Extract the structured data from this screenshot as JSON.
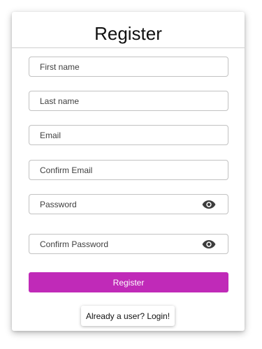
{
  "form": {
    "title": "Register",
    "fields": [
      {
        "placeholder": "First name",
        "value": ""
      },
      {
        "placeholder": "Last name",
        "value": ""
      },
      {
        "placeholder": "Email",
        "value": ""
      },
      {
        "placeholder": "Confirm Email",
        "value": ""
      },
      {
        "placeholder": "Password",
        "value": "",
        "icon": "eye-icon"
      },
      {
        "placeholder": "Confirm Password",
        "value": "",
        "icon": "eye-icon"
      }
    ],
    "register_label": "Register",
    "login_label": "Already a user? Login!"
  },
  "colors": {
    "accent": "#c02ab8",
    "icon": "#3c3c3c"
  }
}
